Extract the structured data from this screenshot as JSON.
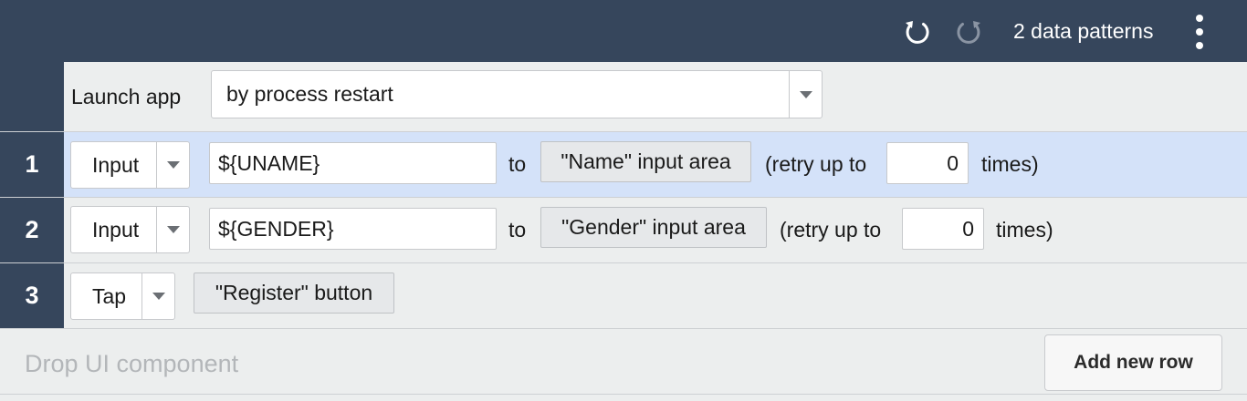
{
  "header": {
    "undo_icon": "undo-icon",
    "redo_icon": "redo-icon",
    "patterns_label": "2 data patterns",
    "menu_icon": "vertical-dots-icon"
  },
  "launch": {
    "label": "Launch app",
    "mode": "by process restart"
  },
  "steps": [
    {
      "number": "1",
      "action": "Input",
      "value": "${UNAME}",
      "to_label": "to",
      "target": "\"Name\" input area",
      "retry_prefix": "(retry up to",
      "retry_count": "0",
      "retry_suffix": "times)"
    },
    {
      "number": "2",
      "action": "Input",
      "value": "${GENDER}",
      "to_label": "to",
      "target": "\"Gender\" input area",
      "retry_prefix": "(retry up to",
      "retry_count": "0",
      "retry_suffix": "times)"
    },
    {
      "number": "3",
      "action": "Tap",
      "target": "\"Register\" button"
    }
  ],
  "footer": {
    "drop_placeholder": "Drop UI component",
    "add_row_label": "Add new row"
  },
  "colors": {
    "header_bg": "#36465c",
    "selected_row": "#d4e2f9",
    "row_bg": "#eceeee"
  }
}
